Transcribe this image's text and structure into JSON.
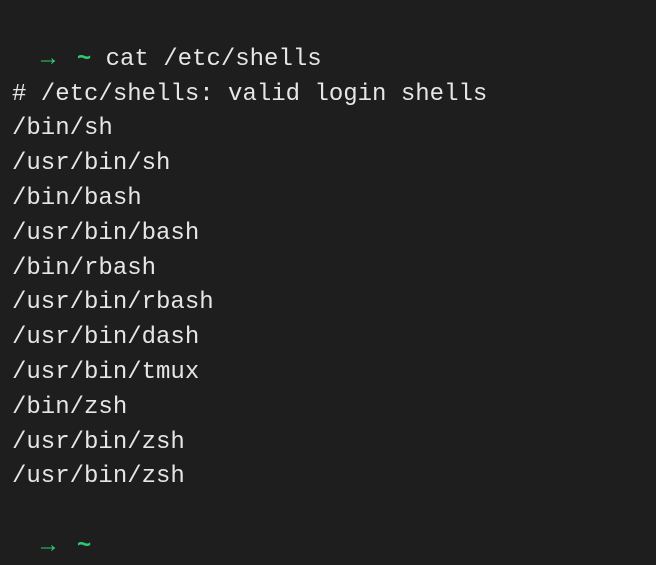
{
  "prompt": {
    "arrow": "→",
    "tilde": "~"
  },
  "command": "cat /etc/shells",
  "output_lines": [
    "# /etc/shells: valid login shells",
    "/bin/sh",
    "/usr/bin/sh",
    "/bin/bash",
    "/usr/bin/bash",
    "/bin/rbash",
    "/usr/bin/rbash",
    "/usr/bin/dash",
    "/usr/bin/tmux",
    "/bin/zsh",
    "/usr/bin/zsh",
    "/usr/bin/zsh"
  ]
}
